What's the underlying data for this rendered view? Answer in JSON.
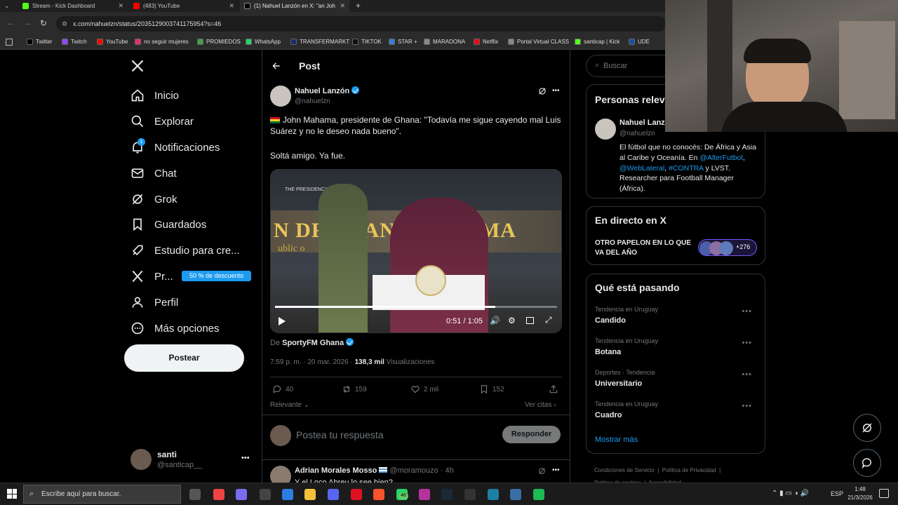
{
  "browser": {
    "tabs": [
      {
        "title": "Stream - Kick Dashboard",
        "color": "#53fc18"
      },
      {
        "title": "(483) YouTube",
        "color": "#ff0000"
      },
      {
        "title": "(1) Nahuel Lanzón en X: \"an Joh",
        "color": "#ffffff"
      }
    ],
    "url": "x.com/nahuelzn/status/2035129003741175954?s=46",
    "bookmarks": [
      "Twitter",
      "Twitch",
      "YouTube",
      "no seguir mujeres",
      "PROMIEDOS",
      "WhatsApp",
      "TRANSFERMARKT",
      "TIKTOK",
      "STAR +",
      "MARADONA",
      "Netflix",
      "Portal Virtual CLASS",
      "santicap | Kick",
      "UDE"
    ]
  },
  "sidebar": {
    "items": [
      {
        "label": "Inicio",
        "icon": "home-icon"
      },
      {
        "label": "Explorar",
        "icon": "search-icon"
      },
      {
        "label": "Notificaciones",
        "icon": "bell-icon"
      },
      {
        "label": "Chat",
        "icon": "mail-icon"
      },
      {
        "label": "Grok",
        "icon": "grok-icon"
      },
      {
        "label": "Guardados",
        "icon": "bookmark-icon"
      },
      {
        "label": "Estudio para cre...",
        "icon": "rocket-icon"
      },
      {
        "label": "Pr...",
        "icon": "x-logo-icon"
      },
      {
        "label": "Perfil",
        "icon": "person-icon"
      },
      {
        "label": "Más opciones",
        "icon": "more-icon"
      }
    ],
    "notif_count": "1",
    "premium_badge": "50 % de descuento",
    "post_button": "Postear",
    "account": {
      "name": "santi",
      "handle": "@santicap__"
    }
  },
  "post": {
    "header_title": "Post",
    "author": {
      "name": "Nahuel Lanzón",
      "handle": "@nahuelzn"
    },
    "text_line1": "John Mahama, presidente de Ghana: \"Todavía me sigue cayendo mal Luis Suárez y no le deseo nada bueno\".",
    "text_line2": "Soltá amigo. Ya fue.",
    "video": {
      "banner_text": "N DRAMANI MAHAMA",
      "subtext": "ublic o",
      "logo_text": "THE PRESIDENCY",
      "time": "0:51 / 1:05",
      "progress": 0.78
    },
    "source_prefix": "De",
    "source_name": "SportyFM Ghana",
    "timestamp": "7:59 p. m. · 20 mar. 2026",
    "views_count": "138,3 mil",
    "views_label": "Visualizaciones",
    "replies": "40",
    "reposts": "159",
    "likes": "2 mil",
    "bookmarks": "152",
    "sort_label": "Relevante",
    "quotes_label": "Ver citas",
    "reply_placeholder": "Postea tu respuesta",
    "reply_button": "Responder",
    "next_reply": {
      "name": "Adrian Morales Mosso",
      "handle": "@moramouzo",
      "time": "· 4h",
      "text": "Y el Loco Abreu lo see bien?"
    }
  },
  "right": {
    "search_placeholder": "Buscar",
    "relevant_title": "Personas relev",
    "person": {
      "name": "Nahuel Lanz",
      "handle": "@nahuelzn",
      "bio_1": "El fútbol que no conocés: De África y Asia al Caribe y Oceanía. En",
      "bio_link1": "@AlterFutbol",
      "bio_link2": "@WebLateral",
      "bio_link3": "#CONTRA",
      "bio_rest": " y LVST. Researcher para Football Manager (África)."
    },
    "live_title": "En directo en X",
    "live_text": "OTRO PAPELON EN LO QUE VA DEL AÑO",
    "live_count": "+276",
    "trends_title": "Qué está pasando",
    "trends": [
      {
        "category": "Tendencia en Uruguay",
        "name": "Candido"
      },
      {
        "category": "Tendencia en Uruguay",
        "name": "Botana"
      },
      {
        "category": "Deportes · Tendencia",
        "name": "Universitario"
      },
      {
        "category": "Tendencia en Uruguay",
        "name": "Cuadro"
      }
    ],
    "show_more": "Mostrar más",
    "footer": [
      "Condiciones de Servicio",
      "Política de Privacidad",
      "Política de cookies",
      "Accesibilidad"
    ]
  },
  "taskbar": {
    "search_placeholder": "Escribe aquí para buscar.",
    "lang": "ESP",
    "time": "1:48",
    "date": "21/3/2026",
    "badge": "46"
  },
  "colors": {
    "accent": "#1d9bf0",
    "background": "#000000",
    "border": "#2f3336",
    "muted": "#71767b"
  }
}
